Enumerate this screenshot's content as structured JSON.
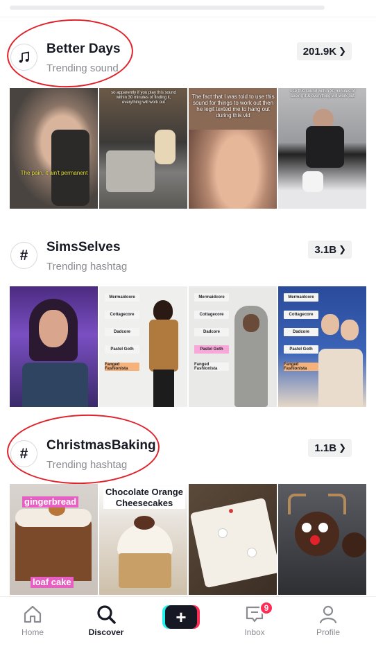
{
  "sections": [
    {
      "title": "Better Days",
      "subtitle": "Trending sound",
      "count": "201.9K",
      "icon": "music-note-icon",
      "captions": [
        "The pain, it ain't permanent",
        "so apparently if you play this sound within 30 minutes of finding it, everything will work out",
        "The fact that I was told to use this sound for things to work out then he legit texted me to hang out during this vid",
        "use this sound within 30 minutes of seeing it & everything will work out"
      ]
    },
    {
      "title": "SimsSelves",
      "subtitle": "Trending hashtag",
      "count": "3.1B",
      "icon": "hashtag-icon",
      "tags": [
        "Mermaidcore",
        "Cottagecore",
        "Dadcore",
        "Pastel Goth",
        "Fanged Fashionista"
      ]
    },
    {
      "title": "ChristmasBaking",
      "subtitle": "Trending hashtag",
      "count": "1.1B",
      "icon": "hashtag-icon",
      "captions": [
        "gingerbread",
        "loaf cake",
        "Chocolate Orange Cheesecakes"
      ]
    }
  ],
  "nav": {
    "home": "Home",
    "discover": "Discover",
    "inbox": "Inbox",
    "inbox_badge": "9",
    "profile": "Profile",
    "create_symbol": "+",
    "active": "Discover"
  },
  "colors": {
    "accent_red": "#e0232b",
    "tiktok_pink": "#fe2c55",
    "tiktok_cyan": "#25f4ee",
    "text_primary": "#161823",
    "text_secondary": "#8a8b91"
  }
}
